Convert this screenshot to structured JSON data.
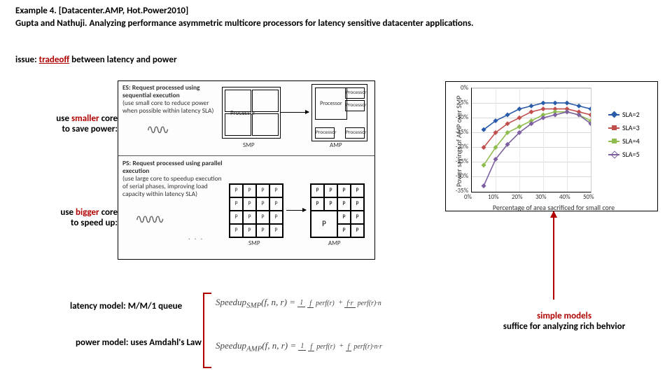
{
  "header": {
    "title_prefix": "Example 4. ",
    "title_bracket": "[Datacenter.AMP, Hot.Power2010]"
  },
  "citation": "Gupta and Nathuji. Analyzing performance asymmetric multicore processors for latency sensitive datacenter applications.",
  "issue": {
    "pre": "issue: ",
    "red": "tradeoff",
    "post": " between latency and power"
  },
  "notes": {
    "smaller_pre": "use ",
    "smaller_red": "smaller",
    "smaller_post": " core\nto save power:",
    "bigger_pre": "use ",
    "bigger_red": "bigger",
    "bigger_post": " core\nto speed up:"
  },
  "diagram": {
    "es_label": "ES: Request processed using sequential execution",
    "es_note": "(use small core to reduce power when possible within latency SLA)",
    "ps_label": "PS: Request processed using parallel execution",
    "ps_note": "(use large core to speedup execution of serial phases, improving load capacity within latency SLA)",
    "proc": "Processor",
    "smp": "SMP",
    "amp": "AMP",
    "p": "P"
  },
  "models": {
    "latency": "latency model: M/M/1 queue",
    "power": "power model: uses Amdahl's Law"
  },
  "equations": {
    "smp": "Speedup<sub>SMP</sub>(f, n, r) = ",
    "amp": "Speedup<sub>AMP</sub>(f, n, r) = ",
    "one": "1",
    "smp_d1t": "f",
    "smp_d1b": "perf(r)",
    "smp_d2t": "f·r",
    "smp_d2b": "perf(r)·n",
    "amp_d1t": "f",
    "amp_d1b": "perf(r)",
    "amp_d2t": "f",
    "amp_d2b": "perf(r)·n·r"
  },
  "conclusion": {
    "red": "simple models",
    "rest": "suffice for analyzing rich behvior"
  },
  "chart_data": {
    "type": "line",
    "title": "",
    "xlabel": "Percentage of area sacrificed for small core",
    "ylabel": "Power savings of AMP over SMP",
    "xticks": [
      "0%",
      "10%",
      "20%",
      "30%",
      "40%",
      "50%"
    ],
    "yticks": [
      "0%",
      "-5%",
      "-10%",
      "-15%",
      "-20%",
      "-25%",
      "-30%",
      "-35%"
    ],
    "xlim": [
      0,
      50
    ],
    "ylim": [
      -35,
      0
    ],
    "series": [
      {
        "name": "SLA=2",
        "color": "#2a5caa",
        "marker": "diamond",
        "x": [
          5,
          10,
          15,
          20,
          25,
          30,
          35,
          40,
          45,
          50
        ],
        "y": [
          -14,
          -11,
          -9,
          -7,
          -6,
          -5,
          -5,
          -5,
          -6,
          -7
        ]
      },
      {
        "name": "SLA=3",
        "color": "#c0504d",
        "marker": "square",
        "x": [
          5,
          10,
          15,
          20,
          25,
          30,
          35,
          40,
          45,
          50
        ],
        "y": [
          -20,
          -15,
          -12,
          -10,
          -8,
          -7,
          -7,
          -7,
          -8,
          -9
        ]
      },
      {
        "name": "SLA=4",
        "color": "#8fbc4f",
        "marker": "triangle",
        "x": [
          5,
          10,
          15,
          20,
          25,
          30,
          35,
          40,
          45,
          50
        ],
        "y": [
          -26,
          -20,
          -15,
          -13,
          -11,
          -9,
          -8,
          -8,
          -9,
          -11
        ]
      },
      {
        "name": "SLA=5",
        "color": "#7d60a0",
        "marker": "x",
        "x": [
          5,
          10,
          15,
          20,
          25,
          30,
          35,
          40,
          45,
          50
        ],
        "y": [
          -33,
          -24,
          -19,
          -15,
          -12,
          -10,
          -9,
          -8,
          -9,
          -12
        ]
      }
    ]
  }
}
